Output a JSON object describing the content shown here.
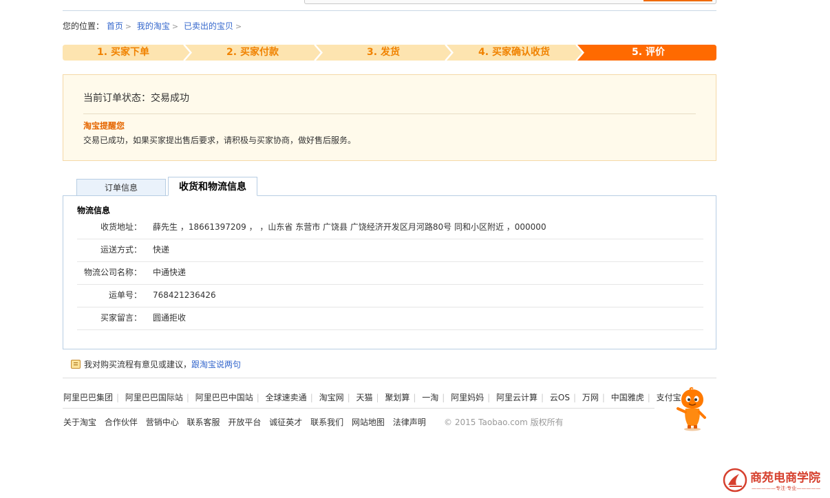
{
  "breadcrumb": {
    "prefix": "您的位置：",
    "items": [
      "首页",
      "我的淘宝",
      "已卖出的宝贝"
    ],
    "separator": ">"
  },
  "steps": [
    {
      "label": "1. 买家下单",
      "active": false
    },
    {
      "label": "2. 买家付款",
      "active": false
    },
    {
      "label": "3. 发货",
      "active": false
    },
    {
      "label": "4. 买家确认收货",
      "active": false
    },
    {
      "label": "5. 评价",
      "active": true
    }
  ],
  "status": {
    "line": "当前订单状态：交易成功",
    "remind_title": "淘宝提醒您",
    "remind_text": "交易已成功，如果买家提出售后要求，请积极与买家协商，做好售后服务。"
  },
  "tabs": [
    {
      "label": "订单信息",
      "active": false
    },
    {
      "label": "收货和物流信息",
      "active": true
    }
  ],
  "logistics": {
    "title": "物流信息",
    "rows": [
      {
        "label": "收货地址：",
        "value": "薛先生 ，18661397209 ， ，山东省 东营市 广饶县 广饶经济开发区月河路80号 同和小区附近 ，000000"
      },
      {
        "label": "运送方式：",
        "value": "快递"
      },
      {
        "label": "物流公司名称：",
        "value": "中通快递"
      },
      {
        "label": "运单号：",
        "value": "768421236426"
      },
      {
        "label": "买家留言：",
        "value": "圆通拒收"
      }
    ]
  },
  "feedback": {
    "text": "我对购买流程有意见或建议，",
    "link": "跟淘宝说两句"
  },
  "footer": {
    "links_row1": [
      "阿里巴巴集团",
      "阿里巴巴国际站",
      "阿里巴巴中国站",
      "全球速卖通",
      "淘宝网",
      "天猫",
      "聚划算",
      "一淘",
      "阿里妈妈",
      "阿里云计算",
      "云OS",
      "万网",
      "中国雅虎",
      "支付宝"
    ],
    "links_row2": [
      "关于淘宝",
      "合作伙伴",
      "营销中心",
      "联系客服",
      "开放平台",
      "诚征英才",
      "联系我们",
      "网站地图",
      "法律声明"
    ],
    "copyright": "© 2015 Taobao.com 版权所有"
  },
  "watermark": {
    "title": "商苑电商学院",
    "subtitle": "—————专注·专业—————"
  },
  "colors": {
    "step_inactive_bg": "#fde4b0",
    "step_active_bg": "#ff6a00",
    "step_text": "#f08200",
    "link": "#3366cc",
    "remind_title": "#e56600"
  },
  "icons": [
    "feedback-icon",
    "taobao-mascot-icon",
    "watermark-logo-icon"
  ]
}
